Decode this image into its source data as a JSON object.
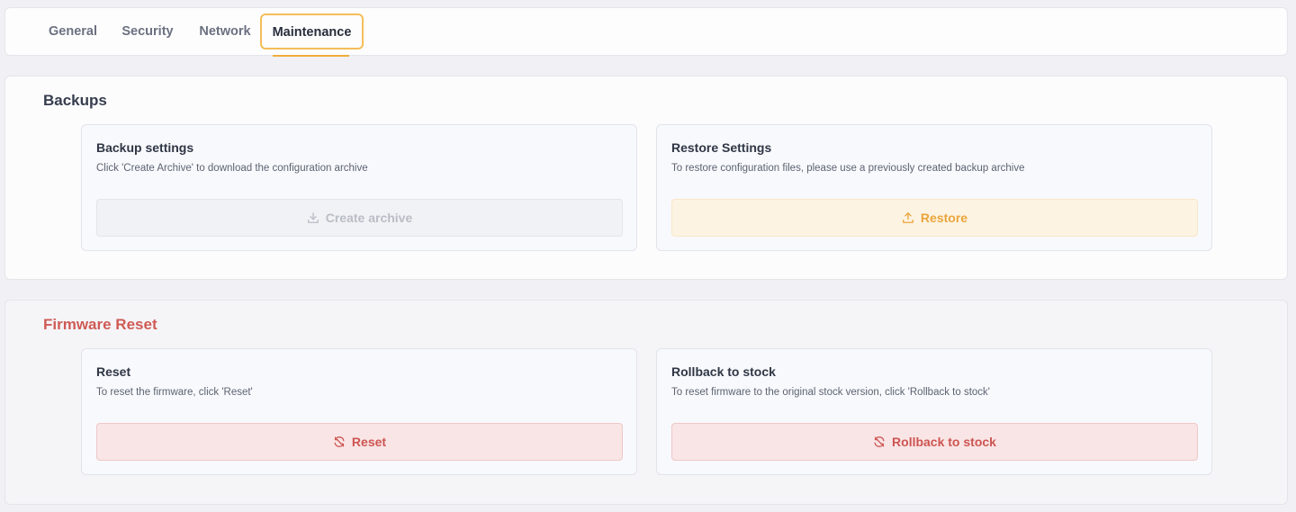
{
  "tabs": {
    "general": "General",
    "security": "Security",
    "network": "Network",
    "maintenance": "Maintenance",
    "active": "maintenance"
  },
  "backups": {
    "title": "Backups",
    "backup_card": {
      "title": "Backup settings",
      "description": "Click 'Create Archive' to download the configuration archive",
      "button_label": "Create archive",
      "button_icon": "download-icon",
      "enabled": false
    },
    "restore_card": {
      "title": "Restore Settings",
      "description": "To restore configuration files, please use a previously created backup archive",
      "button_label": "Restore",
      "button_icon": "upload-icon"
    }
  },
  "firmware": {
    "title": "Firmware Reset",
    "reset_card": {
      "title": "Reset",
      "description": "To reset the firmware, click 'Reset'",
      "button_label": "Reset",
      "button_icon": "reset-icon"
    },
    "rollback_card": {
      "title": "Rollback to stock",
      "description": "To reset firmware to the original stock version, click 'Rollback to stock'",
      "button_label": "Rollback to stock",
      "button_icon": "reset-icon"
    }
  },
  "colors": {
    "accent": "#f0ad3b",
    "danger": "#cd5552",
    "disabled_text": "#b9bdc6"
  }
}
